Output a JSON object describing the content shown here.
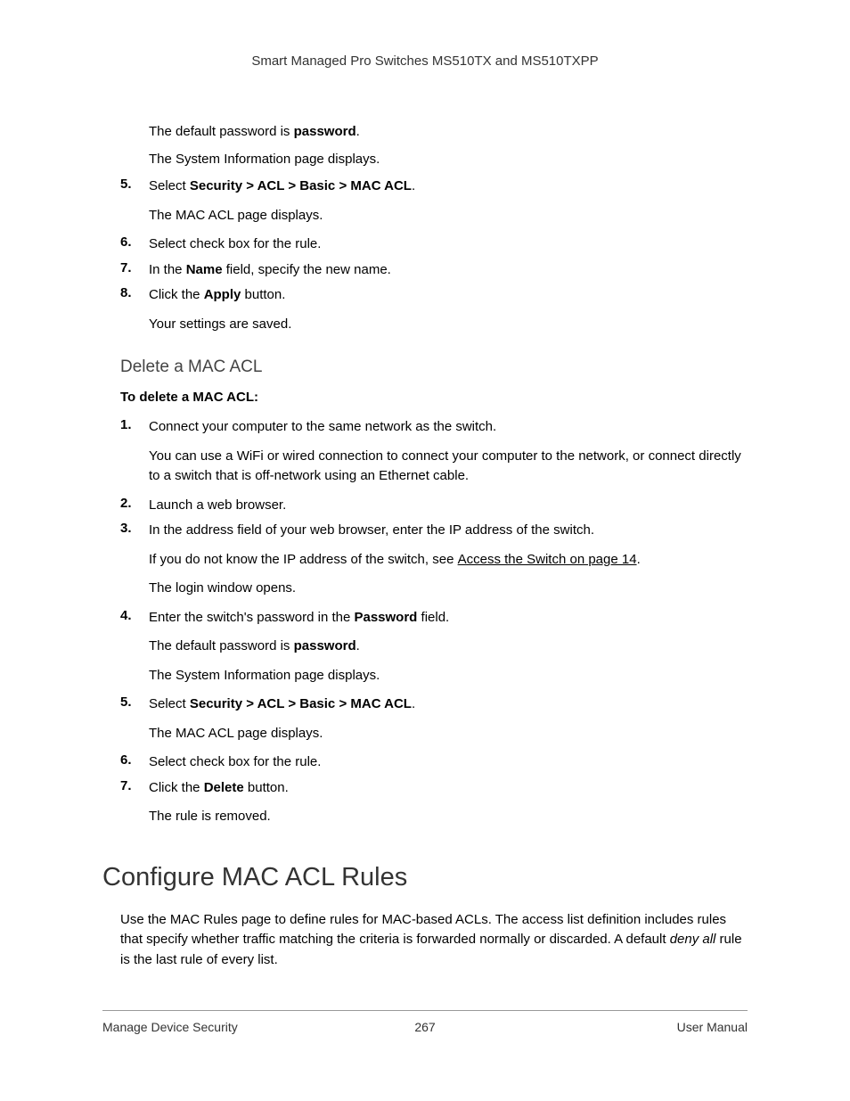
{
  "header": {
    "title": "Smart Managed Pro Switches MS510TX and MS510TXPP"
  },
  "continued_steps": {
    "para_default_pw_pre": "The default password is ",
    "para_default_pw_bold": "password",
    "para_default_pw_post": ".",
    "para_sysinfo": "The System Information page displays.",
    "step5_num": "5.",
    "step5_pre": "Select ",
    "step5_bold": "Security > ACL > Basic > MAC ACL",
    "step5_post": ".",
    "step5_sub": "The MAC ACL page displays.",
    "step6_num": "6.",
    "step6_text": "Select check box for the rule.",
    "step7_num": "7.",
    "step7_pre": "In the ",
    "step7_bold": "Name",
    "step7_post": " field, specify the new name.",
    "step8_num": "8.",
    "step8_pre": "Click the ",
    "step8_bold": "Apply",
    "step8_post": " button.",
    "step8_sub": "Your settings are saved."
  },
  "delete_section": {
    "heading": "Delete a MAC ACL",
    "intro": "To delete a MAC ACL:",
    "step1_num": "1.",
    "step1_text": "Connect your computer to the same network as the switch.",
    "step1_sub": "You can use a WiFi or wired connection to connect your computer to the network, or connect directly to a switch that is off-network using an Ethernet cable.",
    "step2_num": "2.",
    "step2_text": "Launch a web browser.",
    "step3_num": "3.",
    "step3_text": "In the address field of your web browser, enter the IP address of the switch.",
    "step3_sub_pre": "If you do not know the IP address of the switch, see ",
    "step3_sub_link": "Access the Switch on page 14",
    "step3_sub_post": ".",
    "step3_sub2": "The login window opens.",
    "step4_num": "4.",
    "step4_pre": "Enter the switch's password in the ",
    "step4_bold": "Password",
    "step4_post": " field.",
    "step4_sub_pre": "The default password is ",
    "step4_sub_bold": "password",
    "step4_sub_post": ".",
    "step4_sub2": "The System Information page displays.",
    "step5_num": "5.",
    "step5_pre": "Select ",
    "step5_bold": "Security > ACL > Basic > MAC ACL",
    "step5_post": ".",
    "step5_sub": "The MAC ACL page displays.",
    "step6_num": "6.",
    "step6_text": "Select check box for the rule.",
    "step7_num": "7.",
    "step7_pre": "Click the ",
    "step7_bold": "Delete",
    "step7_post": " button.",
    "step7_sub": "The rule is removed."
  },
  "configure_section": {
    "heading": "Configure MAC ACL Rules",
    "para_pre": "Use the MAC Rules page to define rules for MAC-based ACLs. The access list definition includes rules that specify whether traffic matching the criteria is forwarded normally or discarded. A default ",
    "para_italic": "deny all",
    "para_post": " rule is the last rule of every list."
  },
  "footer": {
    "left": "Manage Device Security",
    "center": "267",
    "right": "User Manual"
  }
}
